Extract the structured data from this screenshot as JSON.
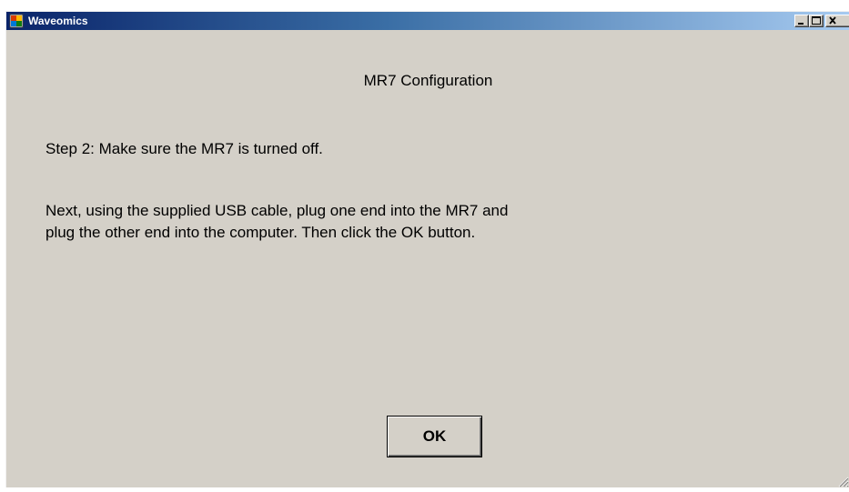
{
  "window": {
    "title": "Waveomics",
    "icon": "application-icon",
    "controls": [
      "minimize-icon",
      "maximize-icon",
      "close-icon"
    ]
  },
  "dialog": {
    "heading": "MR7 Configuration",
    "step_text": "Step 2: Make sure the MR7 is turned off.",
    "instruction_lines": [
      "Next, using the supplied USB cable, plug one end into the MR7 and",
      "plug the other end into the computer.  Then click the OK button."
    ],
    "ok_label": "OK"
  },
  "colors": {
    "dialog_background": "#d4d0c8",
    "titlebar_start": "#0a246a",
    "titlebar_end": "#a6caf0",
    "title_text": "#ffffff",
    "body_text": "#000000"
  }
}
